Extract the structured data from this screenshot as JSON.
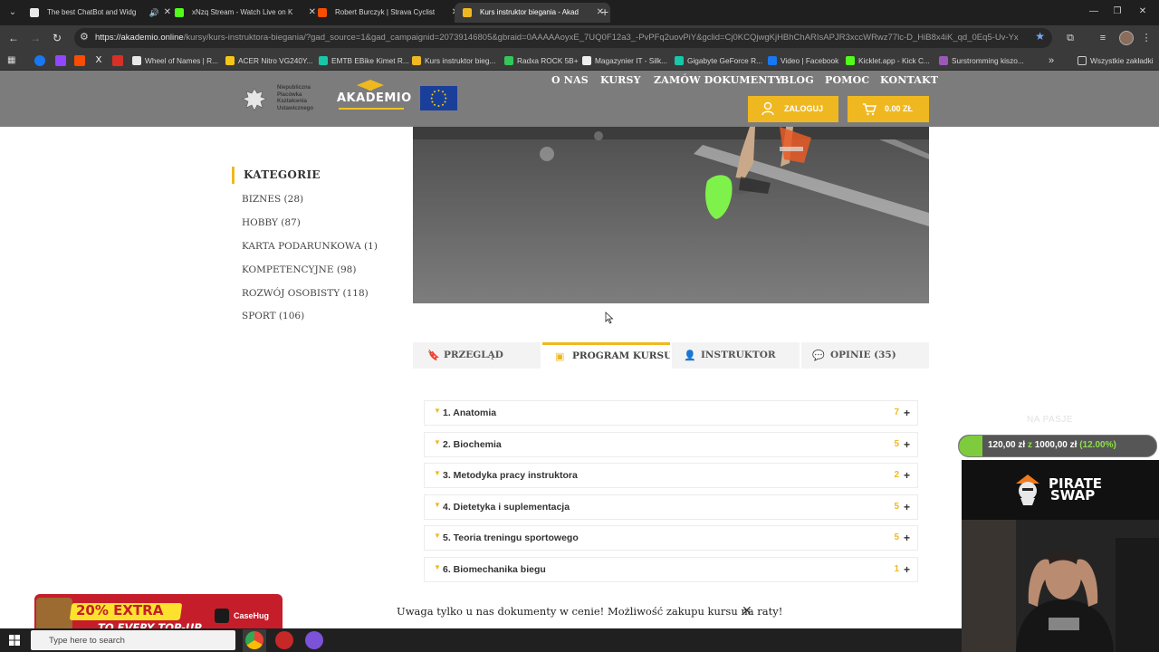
{
  "browser": {
    "tabs": [
      {
        "title": "The best ChatBot and Widg",
        "favicon_color": "#e8e8e8",
        "active": false,
        "audio": true
      },
      {
        "title": "xNzq Stream - Watch Live on K",
        "favicon_color": "#53fc18",
        "active": false,
        "audio": false
      },
      {
        "title": "Robert Burczyk | Strava Cyclist",
        "favicon_color": "#fc4c02",
        "active": false,
        "audio": false
      },
      {
        "title": "Kurs instruktor biegania - Akad",
        "favicon_color": "#f0b820",
        "active": true,
        "audio": false
      }
    ],
    "url_host": "https://akademio.online",
    "url_rest": "/kursy/kurs-instruktora-biegania/?gad_source=1&gad_campaignid=20739146805&gbraid=0AAAAAoyxE_7UQ0F12a3_-PvPFq2uovPiY&gclid=Cj0KCQjwgKjHBhChARIsAPJR3xccWRwz77lc-D_HiB8x4iK_qd_0Eq5-Uv-YxGleUO1qzz...",
    "bookmarks": [
      {
        "label": "Wheel of Names | R...",
        "color": "#e8e8e8"
      },
      {
        "label": "ACER Nitro VG240Y...",
        "color": "#f5c518"
      },
      {
        "label": "EMTB EBike Kimet R...",
        "color": "#18c6a8"
      },
      {
        "label": "Kurs instruktor bieg...",
        "color": "#f0b820"
      },
      {
        "label": "Radxa ROCK 5B+",
        "color": "#34c759"
      },
      {
        "label": "Magazynier IT - Silk...",
        "color": "#eeeeee"
      },
      {
        "label": "Gigabyte GeForce R...",
        "color": "#18c6a8"
      },
      {
        "label": "Video | Facebook",
        "color": "#1877f2"
      },
      {
        "label": "Kicklet.app - Kick C...",
        "color": "#53fc18"
      },
      {
        "label": "Surstromming kiszo...",
        "color": "#9b59b6"
      }
    ],
    "all_bookmarks": "Wszystkie zakładki"
  },
  "header": {
    "emblem_text": "Niepubliczna Placówka Kształcenia Ustawicznego",
    "brand": "AKADEMIO",
    "nav": [
      "O NAS",
      "KURSY",
      "ZAMÓW DOKUMENTY",
      "BLOG",
      "POMOC",
      "KONTAKT"
    ],
    "login_label": "ZALOGUJ",
    "cart_label": "0.00 ZŁ",
    "accent": "#f0b820"
  },
  "sidebar": {
    "title": "KATEGORIE",
    "items": [
      "BIZNES (28)",
      "HOBBY (87)",
      "KARTA PODARUNKOWA (1)",
      "KOMPETENCYJNE (98)",
      "ROZWÓJ OSOBISTY (118)",
      "SPORT (106)"
    ]
  },
  "course_tabs": [
    "PRZEGLĄD",
    "PROGRAM KURSU",
    "INSTRUKTOR",
    "OPINIE (35)"
  ],
  "active_tab": 1,
  "curriculum": [
    {
      "title": "1. Anatomia",
      "count": "7"
    },
    {
      "title": "2. Biochemia",
      "count": "5"
    },
    {
      "title": "3. Metodyka pracy instruktora",
      "count": "2"
    },
    {
      "title": "4. Dietetyka i suplementacja",
      "count": "5"
    },
    {
      "title": "5. Teoria treningu sportowego",
      "count": "5"
    },
    {
      "title": "6. Biomechanika biegu",
      "count": "1"
    }
  ],
  "notice": {
    "text": "Uwaga tylko u nas dokumenty w cenie! Możliwość zakupu kursu na raty!"
  },
  "overlay": {
    "goal_label": "NA PASJE",
    "goal_current": "120,00 zł",
    "goal_sep": "z",
    "goal_total": "1000,00 zł",
    "goal_percent": "(12.00%)",
    "goal_fraction": 0.12,
    "pirate_line1": "PIRATE",
    "pirate_line2": "SWAP",
    "ad_line1": "20% EXTRA",
    "ad_line2": "TO EVERY TOP-UP",
    "ad_brand": "CaseHug"
  },
  "taskbar": {
    "search_placeholder": "Type here to search"
  }
}
